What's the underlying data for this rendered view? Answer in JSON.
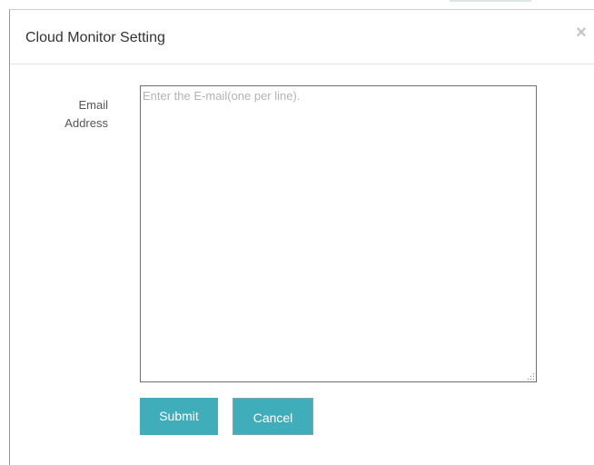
{
  "dialog": {
    "title": "Cloud Monitor Setting",
    "close_glyph": "×"
  },
  "form": {
    "email_label_line1": "Email",
    "email_label_line2": "Address",
    "email_placeholder": "Enter the E-mail(one per line).",
    "email_value": ""
  },
  "buttons": {
    "submit_label": "Submit",
    "cancel_label": "Cancel"
  },
  "colors": {
    "button_bg": "#40aeba",
    "button_text": "#ffffff",
    "placeholder": "#b3b3b3",
    "title_text": "#333333"
  },
  "icons": {
    "close": "close-icon",
    "resize": "resize-grip-icon"
  }
}
